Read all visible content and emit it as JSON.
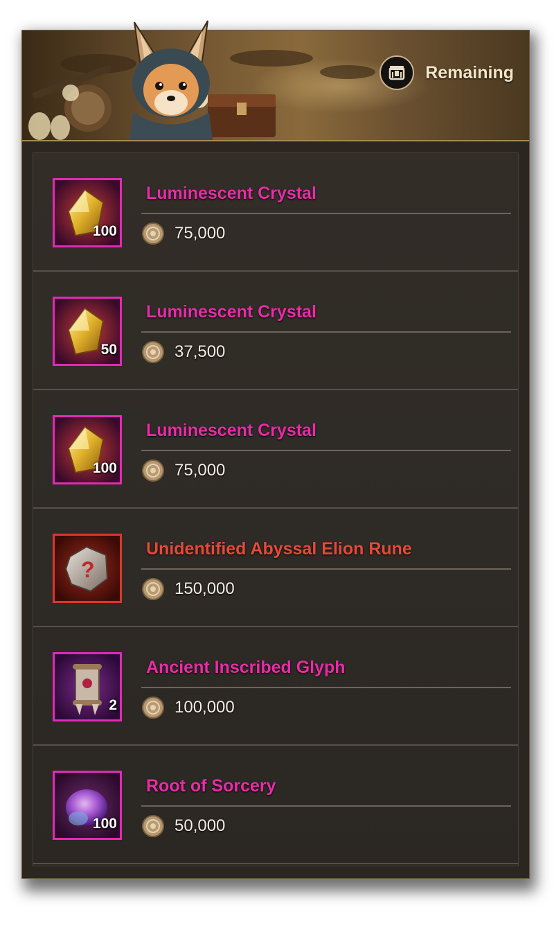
{
  "header": {
    "remaining_label": "Remaining",
    "remaining_icon": "chest-icon"
  },
  "items": [
    {
      "name": "Luminescent Crystal",
      "quantity": "100",
      "price": "75,000",
      "icon": "crystal-icon",
      "rarity_color": "#e82ca8"
    },
    {
      "name": "Luminescent Crystal",
      "quantity": "50",
      "price": "37,500",
      "icon": "crystal-icon",
      "rarity_color": "#e82ca8"
    },
    {
      "name": "Luminescent Crystal",
      "quantity": "100",
      "price": "75,000",
      "icon": "crystal-icon",
      "rarity_color": "#e82ca8"
    },
    {
      "name": "Unidentified Abyssal Elion Rune",
      "quantity": "",
      "price": "150,000",
      "icon": "rune-stone-icon",
      "rarity_color": "#e6493a"
    },
    {
      "name": "Ancient Inscribed Glyph",
      "quantity": "2",
      "price": "100,000",
      "icon": "glyph-scroll-icon",
      "rarity_color": "#e82ca8"
    },
    {
      "name": "Root of Sorcery",
      "quantity": "100",
      "price": "50,000",
      "icon": "sorcery-essence-icon",
      "rarity_color": "#e82ca8"
    }
  ],
  "currency_icon": "coin-icon"
}
